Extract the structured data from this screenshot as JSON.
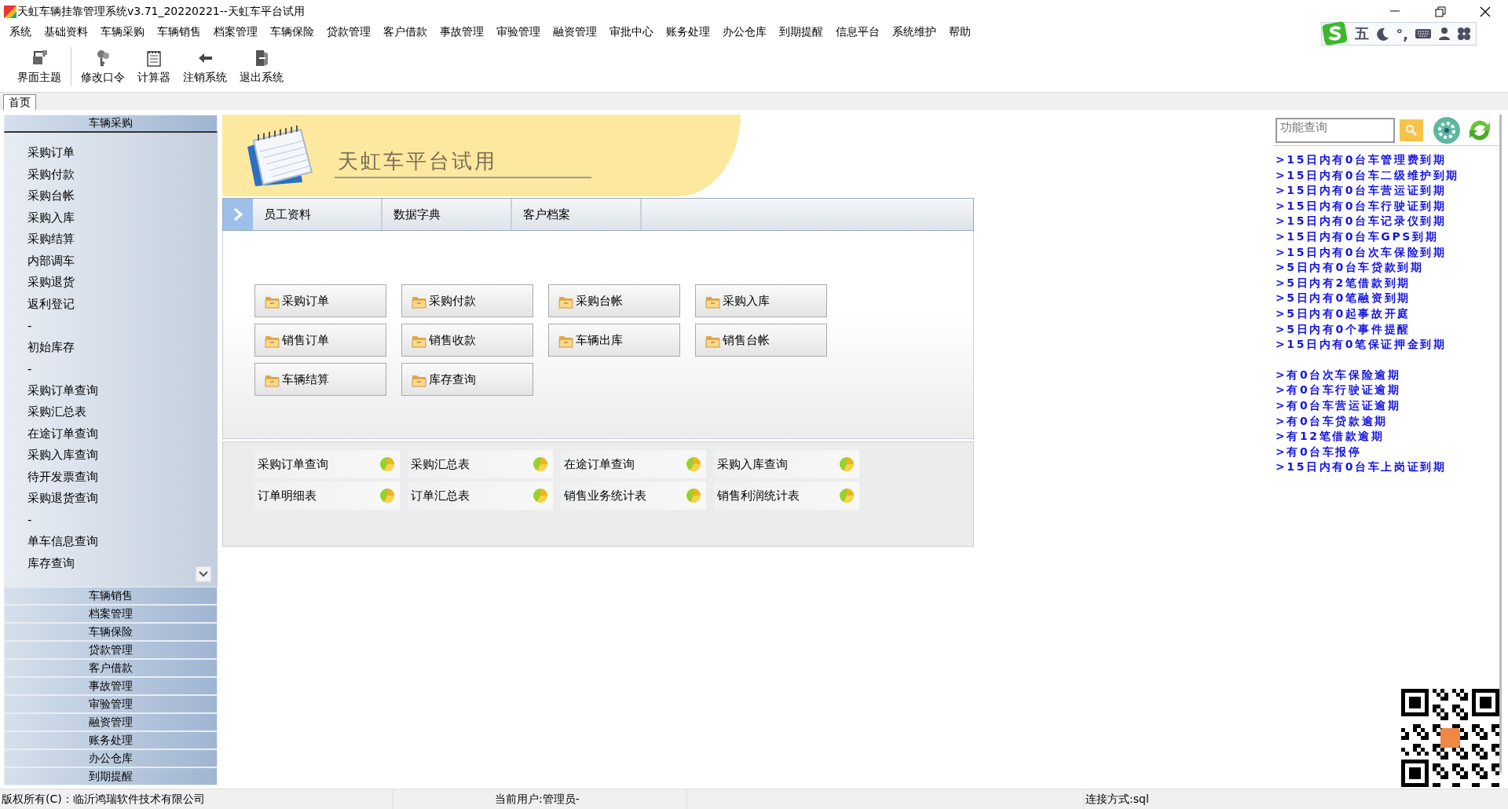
{
  "window": {
    "title": "天虹车辆挂靠管理系统v3.71_20220221--天虹车平台试用"
  },
  "menu": [
    "系统",
    "基础资料",
    "车辆采购",
    "车辆销售",
    "档案管理",
    "车辆保险",
    "贷款管理",
    "客户借款",
    "事故管理",
    "审验管理",
    "融资管理",
    "审批中心",
    "账务处理",
    "办公仓库",
    "到期提醒",
    "信息平台",
    "系统维护",
    "帮助"
  ],
  "ime_bar": {
    "mode": "五",
    "punct": "°,"
  },
  "toolbar": [
    {
      "label": "界面主题",
      "kind": "theme"
    },
    {
      "label": "修改口令",
      "kind": "keys"
    },
    {
      "label": "计算器",
      "kind": "calc"
    },
    {
      "label": "注销系统",
      "kind": "back"
    },
    {
      "label": "退出系统",
      "kind": "exit"
    }
  ],
  "page_tabs": [
    {
      "label": "首页",
      "selected": true
    }
  ],
  "sidebar": {
    "open_section": "车辆采购",
    "items": [
      "采购订单",
      "采购付款",
      "采购台帐",
      "采购入库",
      "采购结算",
      "内部调车",
      "采购退货",
      "返利登记",
      "-",
      "初始库存",
      "-",
      "采购订单查询",
      "采购汇总表",
      "在途订单查询",
      "采购入库查询",
      "待开发票查询",
      "采购退货查询",
      "-",
      "单车信息查询",
      "库存查询"
    ],
    "sections": [
      "车辆销售",
      "档案管理",
      "车辆保险",
      "贷款管理",
      "客户借款",
      "事故管理",
      "审验管理",
      "融资管理",
      "账务处理",
      "办公仓库",
      "到期提醒"
    ]
  },
  "banner": {
    "title": "天虹车平台试用"
  },
  "module_tabs": [
    {
      "label": "员工资料"
    },
    {
      "label": "数据字典"
    },
    {
      "label": "客户档案"
    }
  ],
  "quick_buttons": [
    "采购订单",
    "采购付款",
    "采购台帐",
    "采购入库",
    "销售订单",
    "销售收款",
    "车辆出库",
    "销售台帐",
    "车辆结算",
    "库存查询"
  ],
  "report_links": [
    "采购订单查询",
    "采购汇总表",
    "在途订单查询",
    "采购入库查询",
    "订单明细表",
    "订单汇总表",
    "销售业务统计表",
    "销售利润统计表"
  ],
  "search": {
    "placeholder": "功能查询"
  },
  "due_alerts": [
    ">15日内有0台车管理费到期",
    ">15日内有0台车二级维护到期",
    ">15日内有0台车营运证到期",
    ">15日内有0台车行驶证到期",
    ">15日内有0台车记录仪到期",
    ">15日内有0台车GPS到期",
    ">15日内有0台次车保险到期",
    ">5日内有0台车贷款到期",
    ">5日内有2笔借款到期",
    ">5日内有0笔融资到期",
    ">5日内有0起事故开庭",
    ">5日内有0个事件提醒",
    ">15日内有0笔保证押金到期"
  ],
  "overdue_alerts": [
    ">有0台次车保险逾期",
    ">有0台车行驶证逾期",
    ">有0台车营运证逾期",
    ">有0台车贷款逾期",
    ">有12笔借款逾期",
    ">有0台车报停",
    ">15日内有0台车上岗证到期"
  ],
  "status_bar": {
    "copyright": "版权所有(C)：临沂鸿瑞软件技术有限公司",
    "user": "当前用户:管理员-",
    "connection": "连接方式:sql"
  }
}
